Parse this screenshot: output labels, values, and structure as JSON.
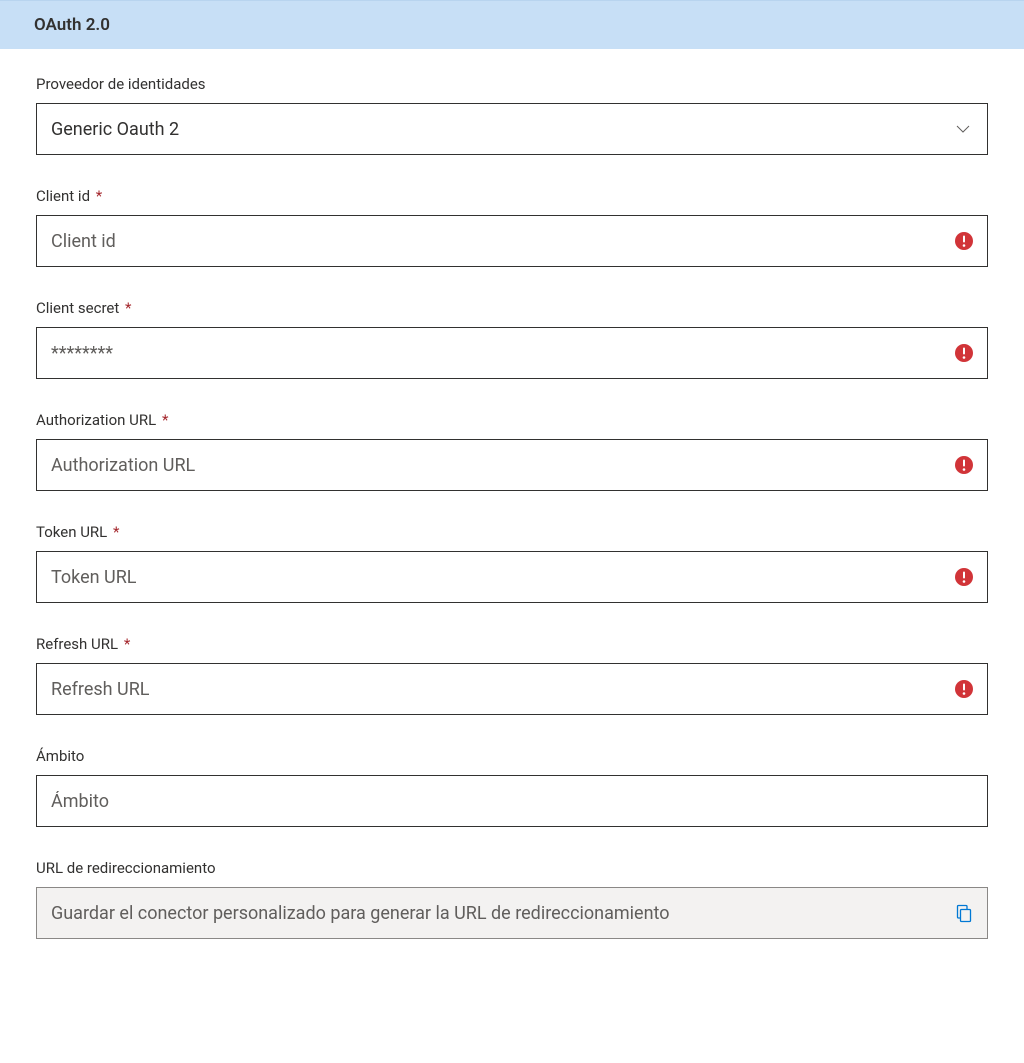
{
  "header": {
    "title": "OAuth 2.0"
  },
  "fields": {
    "identityProvider": {
      "label": "Proveedor de identidades",
      "value": "Generic Oauth 2"
    },
    "clientId": {
      "label": "Client id",
      "placeholder": "Client id",
      "required": "*"
    },
    "clientSecret": {
      "label": "Client secret",
      "placeholder": "********",
      "required": "*"
    },
    "authorizationUrl": {
      "label": "Authorization URL",
      "placeholder": "Authorization URL",
      "required": "*"
    },
    "tokenUrl": {
      "label": "Token URL",
      "placeholder": "Token URL",
      "required": "*"
    },
    "refreshUrl": {
      "label": "Refresh URL",
      "placeholder": "Refresh URL",
      "required": "*"
    },
    "scope": {
      "label": "Ámbito",
      "placeholder": "Ámbito"
    },
    "redirectUrl": {
      "label": "URL de redireccionamiento",
      "placeholder": "Guardar el conector personalizado para generar la URL de redireccionamiento"
    }
  }
}
